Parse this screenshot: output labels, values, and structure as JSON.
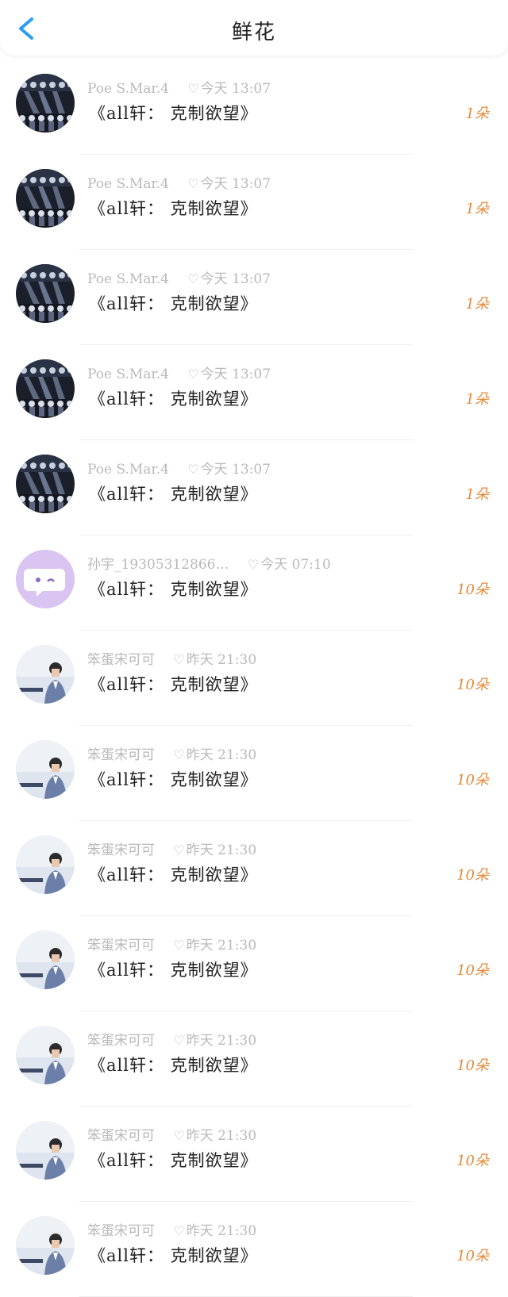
{
  "header": {
    "title": "鲜花"
  },
  "rows": [
    {
      "user": "Poe S.Mar.4",
      "time": "今天 13:07",
      "work": "《all轩： 克制欲望》",
      "count": "1朵",
      "avatar": "stage"
    },
    {
      "user": "Poe S.Mar.4",
      "time": "今天 13:07",
      "work": "《all轩： 克制欲望》",
      "count": "1朵",
      "avatar": "stage"
    },
    {
      "user": "Poe S.Mar.4",
      "time": "今天 13:07",
      "work": "《all轩： 克制欲望》",
      "count": "1朵",
      "avatar": "stage"
    },
    {
      "user": "Poe S.Mar.4",
      "time": "今天 13:07",
      "work": "《all轩： 克制欲望》",
      "count": "1朵",
      "avatar": "stage"
    },
    {
      "user": "Poe S.Mar.4",
      "time": "今天 13:07",
      "work": "《all轩： 克制欲望》",
      "count": "1朵",
      "avatar": "stage"
    },
    {
      "user": "孙宇_19305312866…",
      "time": "今天 07:10",
      "work": "《all轩： 克制欲望》",
      "count": "10朵",
      "avatar": "chat"
    },
    {
      "user": "笨蛋宋可可",
      "time": "昨天 21:30",
      "work": "《all轩： 克制欲望》",
      "count": "10朵",
      "avatar": "person"
    },
    {
      "user": "笨蛋宋可可",
      "time": "昨天 21:30",
      "work": "《all轩： 克制欲望》",
      "count": "10朵",
      "avatar": "person"
    },
    {
      "user": "笨蛋宋可可",
      "time": "昨天 21:30",
      "work": "《all轩： 克制欲望》",
      "count": "10朵",
      "avatar": "person"
    },
    {
      "user": "笨蛋宋可可",
      "time": "昨天 21:30",
      "work": "《all轩： 克制欲望》",
      "count": "10朵",
      "avatar": "person"
    },
    {
      "user": "笨蛋宋可可",
      "time": "昨天 21:30",
      "work": "《all轩： 克制欲望》",
      "count": "10朵",
      "avatar": "person"
    },
    {
      "user": "笨蛋宋可可",
      "time": "昨天 21:30",
      "work": "《all轩： 克制欲望》",
      "count": "10朵",
      "avatar": "person"
    },
    {
      "user": "笨蛋宋可可",
      "time": "昨天 21:30",
      "work": "《all轩： 克制欲望》",
      "count": "10朵",
      "avatar": "person"
    }
  ],
  "colors": {
    "accent": "#2a9df4",
    "count": "#e58a3a",
    "meta": "#b9b9b9"
  },
  "icons": {
    "back": "chevron-left-icon"
  }
}
